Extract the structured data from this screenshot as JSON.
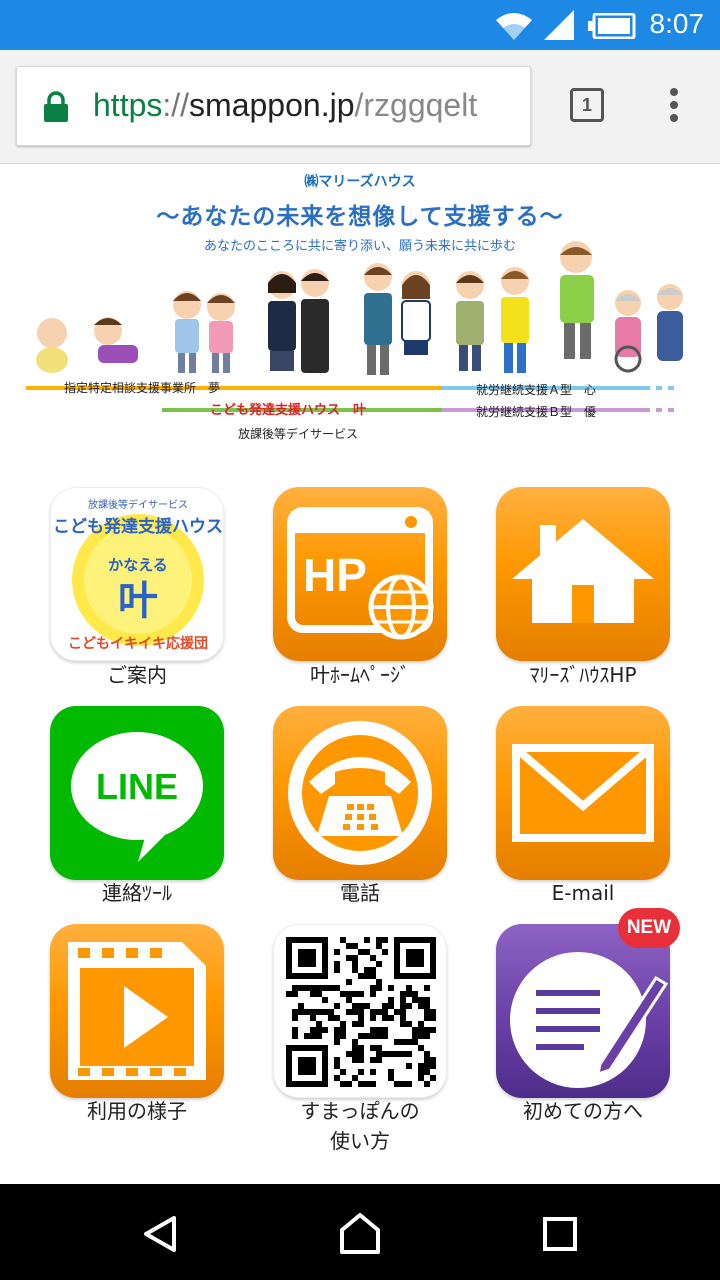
{
  "status_bar": {
    "time": "8:07",
    "icons": [
      "wifi-icon",
      "signal-icon",
      "battery-icon"
    ]
  },
  "browser": {
    "url_scheme": "https",
    "url_sep": "://",
    "url_host": "smappon.jp",
    "url_path": "/rzggqelt",
    "tab_count": "1"
  },
  "banner": {
    "company": "㈱マリーズハウス",
    "slogan": "～あなたの未来を想像して支援する～",
    "subslogan": "あなたのこころに共に寄り添い、願う未来に共に歩む",
    "service_1": "指定特定相談支援事業所　夢",
    "service_2": "こども発達支援ハウス　叶",
    "service_3": "放課後等デイサービス",
    "service_4": "就労継続支援Ａ型　心",
    "service_5": "就労継続支援Ｂ型　優"
  },
  "tile_text": {
    "line_logo": "LINE",
    "hp_logo": "HP",
    "kanaeru_top": "放課後等デイサービス",
    "kanaeru_title": "こども発達支援ハウス",
    "kanaeru_sub": "かなえる",
    "kanaeru_kanji": "叶",
    "kanaeru_bottom": "こどもイキイキ応援団"
  },
  "tiles": [
    {
      "label": "ご案内"
    },
    {
      "label": "叶ﾎｰﾑﾍﾟｰｼﾞ"
    },
    {
      "label": "ﾏﾘｰｽﾞﾊｳｽHP"
    },
    {
      "label": "連絡ﾂｰﾙ"
    },
    {
      "label": "電話"
    },
    {
      "label": "E-mail"
    },
    {
      "label": "利用の様子"
    },
    {
      "label": "すまっぽんの\n使い方"
    },
    {
      "label": "初めての方へ"
    }
  ],
  "new_badge": "NEW",
  "colors": {
    "status_bar": "#1e88e5",
    "orange": "#ff9800",
    "line_green": "#00b900",
    "purple": "#6a3fa6",
    "new_red": "#e8303a"
  }
}
